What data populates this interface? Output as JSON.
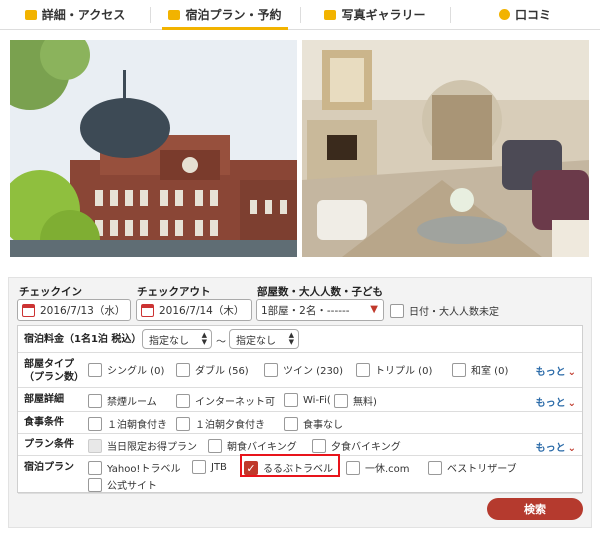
{
  "tabs": [
    {
      "label": "詳細・アクセス",
      "icon": "building-icon"
    },
    {
      "label": "宿泊プラン・予約",
      "icon": "bed-icon",
      "active": true
    },
    {
      "label": "写真ギャラリー",
      "icon": "camera-icon"
    },
    {
      "label": "口コミ",
      "icon": "chat-icon"
    }
  ],
  "search": {
    "checkin_label": "チェックイン",
    "checkin_value": "2016/7/13（水）",
    "checkout_label": "チェックアウト",
    "checkout_value": "2016/7/14（木）",
    "rooms_label": "部屋数・大人人数・子ども",
    "rooms_value": "1部屋・2名・------",
    "undecided_label": "日付・大人人数未定",
    "price_label": "宿泊料金（1名1泊 税込）",
    "price_min": "指定なし",
    "price_sep": "〜",
    "price_max": "指定なし",
    "room_type_label_1": "部屋タイプ",
    "room_type_label_2": "（プラン数）",
    "room_types": [
      "シングル (0)",
      "ダブル (56)",
      "ツイン (230)",
      "トリプル (0)",
      "和室 (0)"
    ],
    "room_detail_label": "部屋詳細",
    "room_details": [
      "禁煙ルーム",
      "インターネット可",
      "Wi-Fi(",
      "無料)"
    ],
    "meal_label": "食事条件",
    "meals": [
      "１泊朝食付き",
      "１泊朝夕食付き",
      "食事なし"
    ],
    "plan_cond_label": "プラン条件",
    "plan_conds": [
      "当日限定お得プラン",
      "朝食バイキング",
      "夕食バイキング"
    ],
    "site_label": "宿泊プラン",
    "sites": [
      "Yahoo!トラベル",
      "JTB",
      "るるぶトラベル",
      "一休.com",
      "ベストリザーブ",
      "公式サイト"
    ],
    "more_label": "もっと",
    "search_button": "検索"
  },
  "colors": {
    "accent": "#f2b300",
    "brand_red": "#b53a2e",
    "link": "#2a6aa8",
    "highlight": "#e8141b"
  }
}
